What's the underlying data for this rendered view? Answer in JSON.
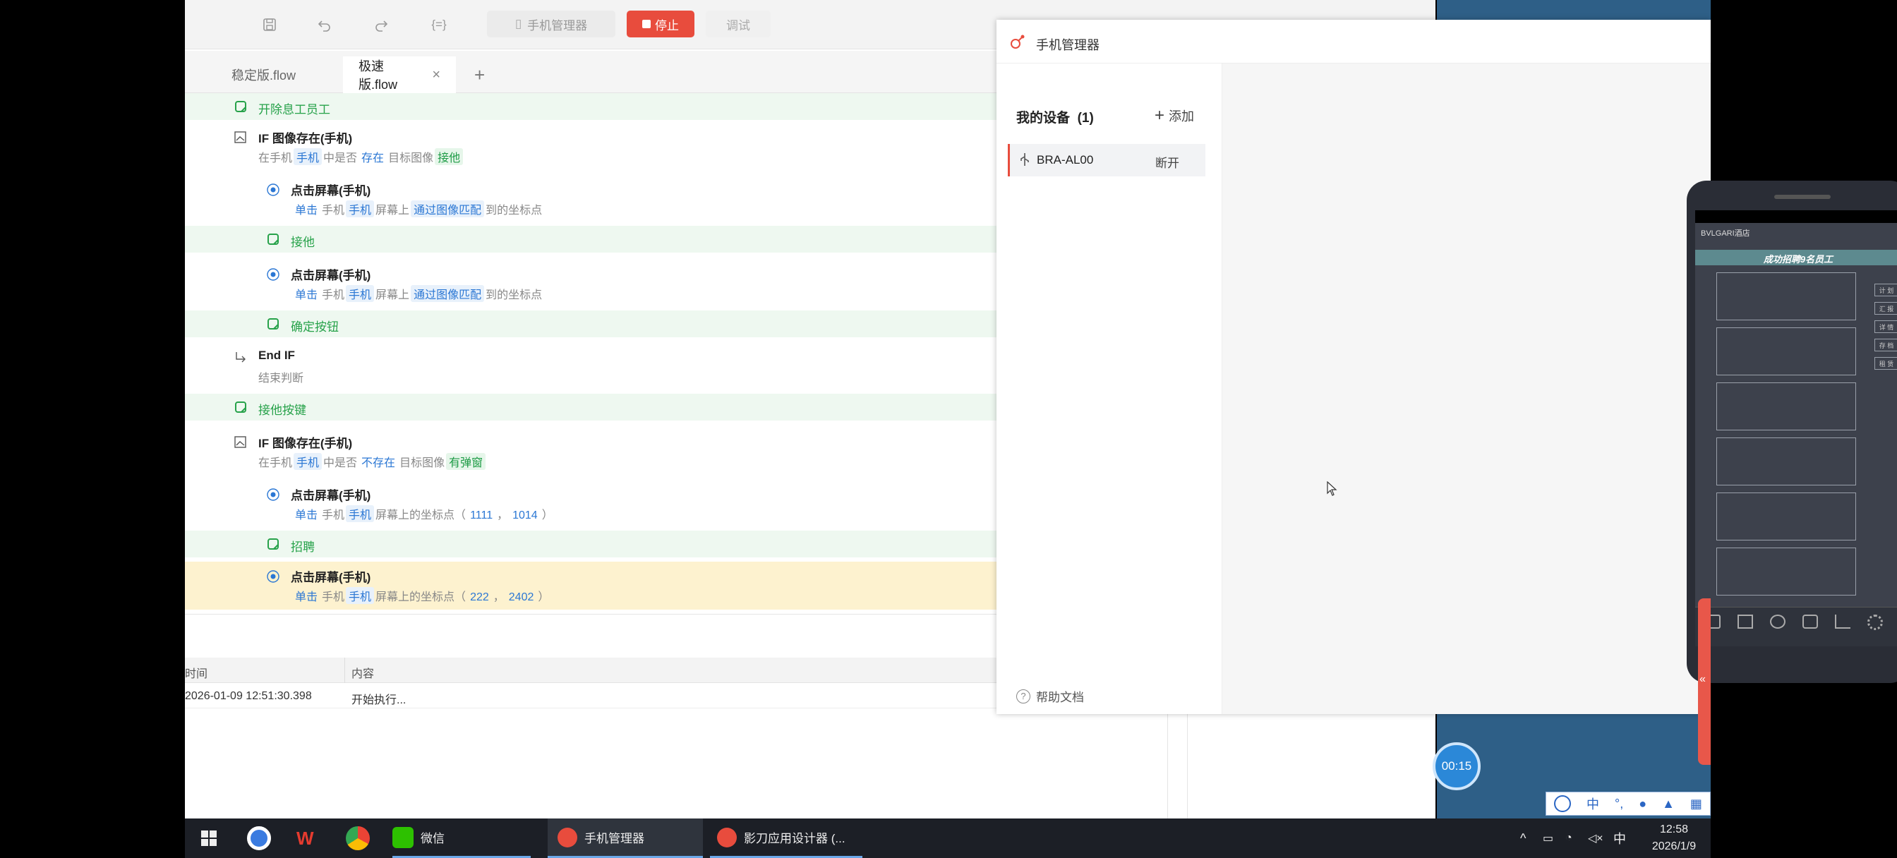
{
  "toolbar": {
    "phone_manager_label": "手机管理器",
    "stop_label": "停止",
    "debug_label": "调试",
    "stop_color": "#e84c3d"
  },
  "tabs": [
    {
      "label": "稳定版.flow",
      "active": false
    },
    {
      "label": "极速版.flow",
      "active": true,
      "close": "×"
    }
  ],
  "tabs_add": "+",
  "flow": {
    "r1_note": "开除息工员工",
    "r2_title": "IF 图像存在(手机)",
    "r2_p1": "在手机",
    "r2_t1": "手机",
    "r2_p2": "中是否",
    "r2_t2": "存在",
    "r2_p3": "目标图像",
    "r2_t3": "接他",
    "r3_title": "点击屏幕(手机)",
    "r3_t0": "单击",
    "r3_p1": "手机",
    "r3_t1": "手机",
    "r3_p2": "屏幕上",
    "r3_t2": "通过图像匹配",
    "r3_p3": "到的坐标点",
    "r4_note": "接他",
    "r5_title": "点击屏幕(手机)",
    "r5_t0": "单击",
    "r5_p1": "手机",
    "r5_t1": "手机",
    "r5_p2": "屏幕上",
    "r5_t2": "通过图像匹配",
    "r5_p3": "到的坐标点",
    "r6_note": "确定按钮",
    "r7_title": "End IF",
    "r7_sub": "结束判断",
    "r8_note": "接他按键",
    "r9_title": "IF 图像存在(手机)",
    "r9_p1": "在手机",
    "r9_t1": "手机",
    "r9_p2": "中是否",
    "r9_t2": "不存在",
    "r9_p3": "目标图像",
    "r9_t3": "有弹窗",
    "r10_title": "点击屏幕(手机)",
    "r10_t0": "单击",
    "r10_p1": "手机",
    "r10_t1": "手机",
    "r10_p2": "屏幕上的坐标点（",
    "r10_x": "1111",
    "r10_sep": "，",
    "r10_y": "1014",
    "r10_p3": "）",
    "r11_note": "招聘",
    "r12_title": "点击屏幕(手机)",
    "r12_t0": "单击",
    "r12_p1": "手机",
    "r12_t1": "手机",
    "r12_p2": "屏幕上的坐标点（",
    "r12_x": "222",
    "r12_sep": "，",
    "r12_y": "2402",
    "r12_p3": "）"
  },
  "log": {
    "col_time": "时间",
    "col_content": "内容",
    "row_time": "2026-01-09 12:51:30.398",
    "row_content": "开始执行..."
  },
  "phone_manager": {
    "title": "手机管理器",
    "my_devices": "我的设备",
    "device_count": "(1)",
    "add": "添加",
    "device_name": "BRA-AL00",
    "disconnect": "断开",
    "help": "帮助文档"
  },
  "phone_screen": {
    "header_left": "BVLGARI酒店",
    "banner": "成功招聘9名员工",
    "side_buttons": [
      "计 划",
      "汇 报",
      "详 情",
      "存 档",
      "租 赁"
    ]
  },
  "timer": "00:15",
  "ime": [
    "中"
  ],
  "taskbar": {
    "wechat": "微信",
    "phone_manager": "手机管理器",
    "designer": "影刀应用设计器 (...",
    "ime_lang": "中",
    "time": "12:58",
    "date": "2026/1/9"
  }
}
